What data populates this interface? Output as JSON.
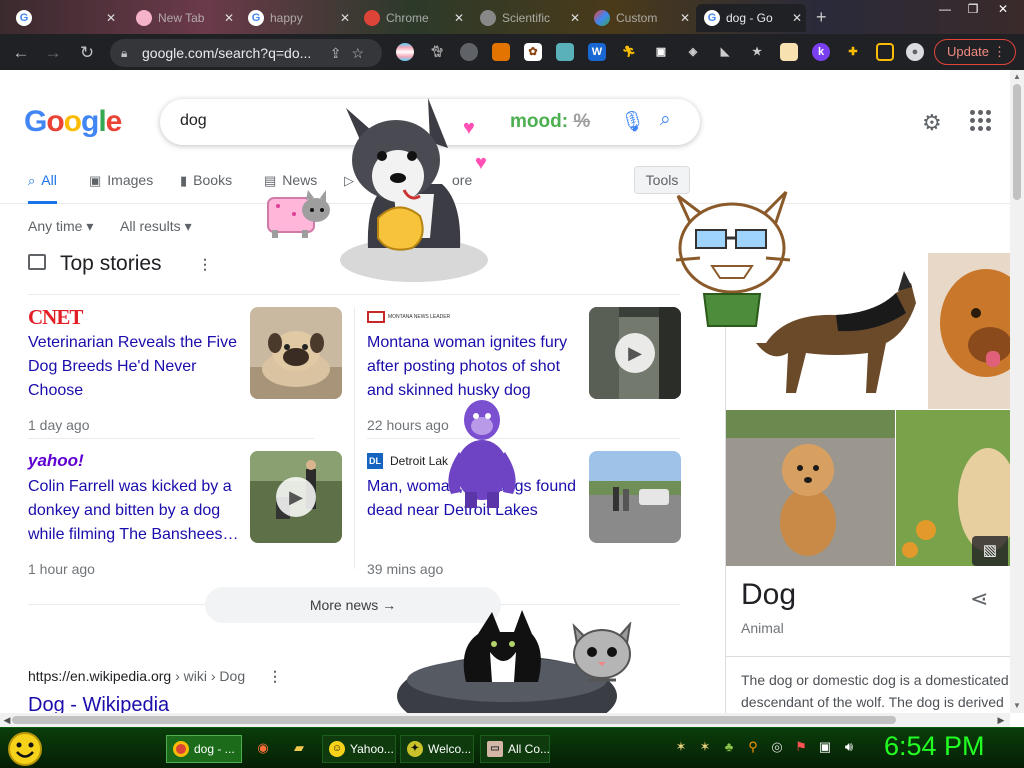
{
  "browser": {
    "tabs": [
      {
        "label": "",
        "icon": "google-icon"
      },
      {
        "label": "",
        "icon": "blank-icon"
      },
      {
        "label": "New Tab",
        "icon": "face-icon"
      },
      {
        "label": "happy",
        "icon": "google-icon"
      },
      {
        "label": "Chrome",
        "icon": "chrome-icon"
      },
      {
        "label": "Scientific",
        "icon": "chrome-icon"
      },
      {
        "label": "Custom",
        "icon": "play-icon"
      },
      {
        "label": "dog - Go",
        "icon": "google-icon"
      }
    ],
    "omnibox_url": "google.com/search?q=do...",
    "update_label": "Update"
  },
  "google": {
    "logo": "Google",
    "query": "dog",
    "mood_label": "mood: ",
    "mood_value": "%",
    "nav_tabs": [
      "All",
      "Images",
      "Books",
      "News",
      "",
      "ore"
    ],
    "tools_label": "Tools",
    "filters": [
      "Any time ▾",
      "All results ▾"
    ]
  },
  "top_stories": {
    "heading": "Top stories",
    "items": [
      {
        "source": "CNET",
        "headline": "Veterinarian Reveals the Five Dog Breeds He'd Never Choose",
        "time": "1 day ago",
        "has_video": false
      },
      {
        "source": "",
        "headline": "Montana woman ignites fury after posting photos of shot and skinned husky dog",
        "time": "22 hours ago",
        "has_video": true
      },
      {
        "source": "yahoo!",
        "headline": "Colin Farrell was kicked by a donkey and bitten by a dog while filming The Banshees…",
        "time": "1 hour ago",
        "has_video": true
      },
      {
        "source": "Detroit Lak",
        "source_badge": "DL",
        "headline": "Man, woman, two dogs found dead near Detroit Lakes",
        "time": "39 mins ago",
        "has_video": false
      }
    ],
    "more_news": "More news"
  },
  "wiki_result": {
    "url": "https://en.wikipedia.org",
    "crumb": " › wiki › Dog",
    "title": "Dog - Wikipedia"
  },
  "knowledge_panel": {
    "title": "Dog",
    "subtitle": "Animal",
    "description_line1": "The dog or domestic dog is a domesticated",
    "description_line2": "descendant of the wolf. The dog is derived"
  },
  "taskbar": {
    "items": [
      {
        "label": "dog - ...",
        "icon": "chrome-icon",
        "active": true
      },
      {
        "label": "Yahoo...",
        "icon": "smiley-icon",
        "active": false
      },
      {
        "label": "Welco...",
        "icon": "star-icon",
        "active": false
      },
      {
        "label": "All Co...",
        "icon": "window-icon",
        "active": false
      }
    ],
    "clock": "6:54 PM"
  },
  "colors": {
    "google_blue": "#4285f4",
    "google_red": "#ea4335",
    "google_yellow": "#fbbc05",
    "google_green": "#34a853",
    "link": "#1a0dab",
    "clock_green": "#22ff22"
  }
}
